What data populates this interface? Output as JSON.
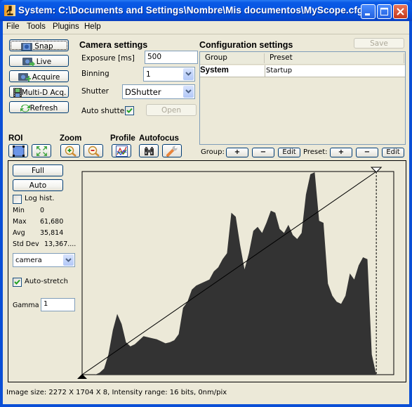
{
  "window": {
    "title": "System: C:\\Documents and Settings\\Nombre\\Mis documentos\\MyScope.cfg",
    "app_icon": "microscope-icon",
    "controls": [
      "minimize",
      "maximize",
      "close"
    ]
  },
  "menubar": {
    "items": [
      {
        "label": "File"
      },
      {
        "label": "Tools"
      },
      {
        "label": "Plugins"
      },
      {
        "label": "Help"
      }
    ]
  },
  "acquisition_buttons": [
    {
      "label": "Snap",
      "icon": "camera-icon"
    },
    {
      "label": "Live",
      "icon": "camera-live-icon"
    },
    {
      "label": "Acquire",
      "icon": "camera-plus-icon"
    },
    {
      "label": "Multi-D Acq.",
      "icon": "film-icon"
    },
    {
      "label": "Refresh",
      "icon": "refresh-icon"
    }
  ],
  "camera_settings": {
    "heading": "Camera settings",
    "exposure_label": "Exposure [ms]",
    "exposure_value": "500",
    "binning_label": "Binning",
    "binning_value": "1",
    "shutter_label": "Shutter",
    "shutter_value": "DShutter",
    "auto_shutter_label": "Auto shutter",
    "auto_shutter_checked": true,
    "open_label": "Open"
  },
  "configuration_settings": {
    "heading": "Configuration settings",
    "save_label": "Save",
    "columns": [
      "Group",
      "Preset"
    ],
    "rows": [
      {
        "group": "System",
        "preset": "Startup"
      }
    ],
    "group_label": "Group:",
    "preset_label": "Preset:",
    "add_label": "+",
    "remove_label": "−",
    "edit_label": "Edit"
  },
  "toolbar_groups": {
    "roi": "ROI",
    "zoom": "Zoom",
    "profile": "Profile",
    "autofocus": "Autofocus"
  },
  "histogram_controls": {
    "full_label": "Full",
    "auto_label": "Auto",
    "log_hist_label": "Log hist.",
    "log_hist_checked": false,
    "stats": [
      {
        "label": "Min",
        "value": "0"
      },
      {
        "label": "Max",
        "value": "61,680"
      },
      {
        "label": "Avg",
        "value": "35,814"
      },
      {
        "label": "Std Dev",
        "value": "13,367...."
      }
    ],
    "channel_value": "camera",
    "auto_stretch_label": "Auto-stretch",
    "auto_stretch_checked": true,
    "gamma_label": "Gamma",
    "gamma_value": "1"
  },
  "histogram": {
    "fill_color": "#333333",
    "background": "#ece9d8",
    "low_marker": 0.0,
    "high_marker": 0.944,
    "profile": [
      0,
      0,
      0,
      0,
      0.01,
      0.03,
      0.1,
      0.22,
      0.3,
      0.25,
      0.16,
      0.14,
      0.15,
      0.17,
      0.19,
      0.185,
      0.18,
      0.175,
      0.165,
      0.155,
      0.16,
      0.17,
      0.2,
      0.33,
      0.36,
      0.42,
      0.44,
      0.45,
      0.46,
      0.47,
      0.51,
      0.53,
      0.57,
      0.6,
      0.8,
      0.78,
      0.64,
      0.52,
      0.6,
      0.71,
      0.73,
      0.7,
      0.75,
      0.81,
      0.8,
      0.72,
      0.7,
      0.74,
      0.69,
      0.67,
      0.7,
      0.89,
      0.99,
      1.0,
      0.76,
      0.75,
      0.45,
      0.39,
      0.36,
      0.35,
      0.39,
      0.5,
      0.47,
      0.54,
      0.58,
      0.57,
      0.1,
      0.0,
      0,
      0,
      0,
      0
    ]
  },
  "status_bar": {
    "text": "Image size: 2272 X 1704 X 8, Intensity range: 16 bits, 0nm/pix"
  }
}
